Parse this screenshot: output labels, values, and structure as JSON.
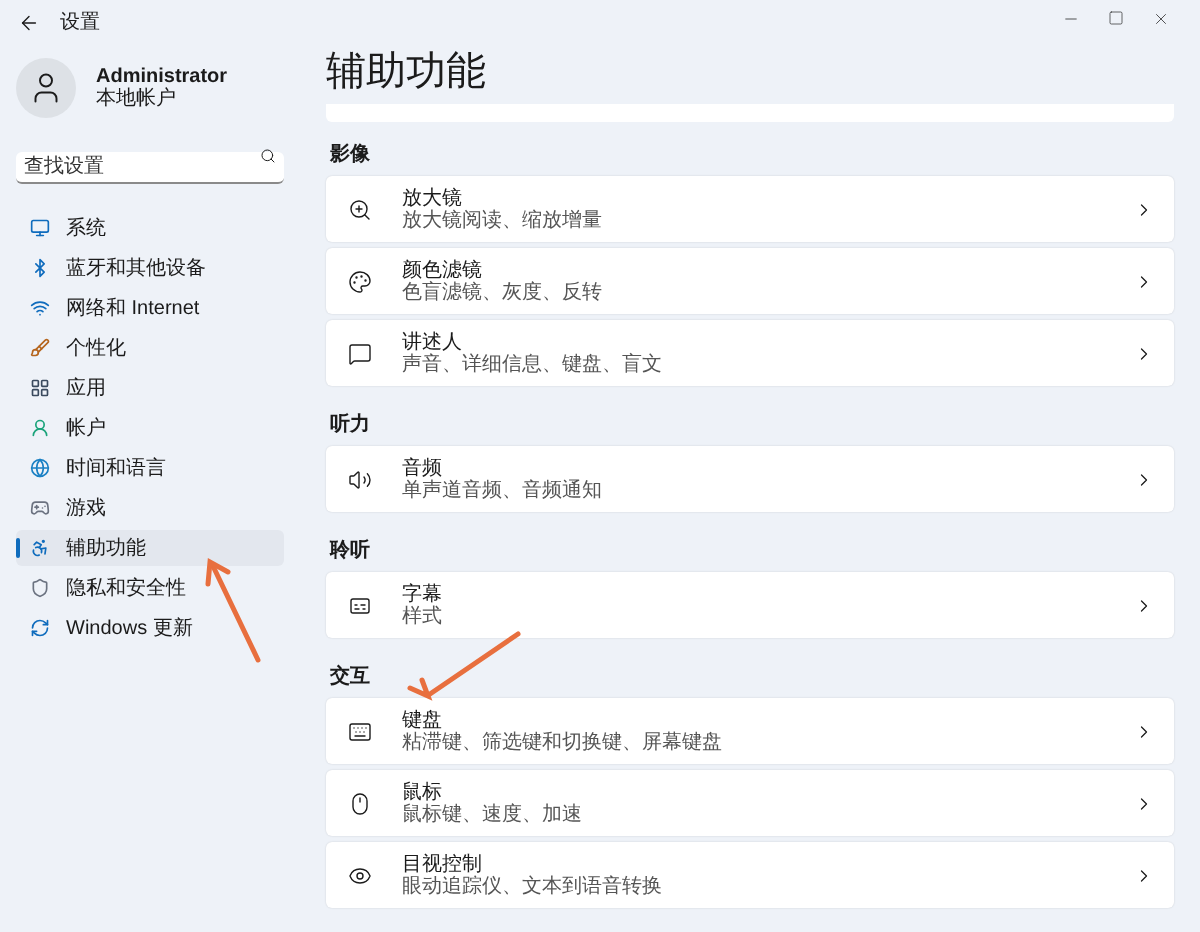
{
  "window": {
    "title": "设置"
  },
  "user": {
    "name": "Administrator",
    "account": "本地帐户"
  },
  "search": {
    "placeholder": "查找设置"
  },
  "nav": [
    {
      "kind": "system",
      "label": "系统",
      "selected": false
    },
    {
      "kind": "bluetooth",
      "label": "蓝牙和其他设备",
      "selected": false
    },
    {
      "kind": "network",
      "label": "网络和 Internet",
      "selected": false
    },
    {
      "kind": "personalize",
      "label": "个性化",
      "selected": false
    },
    {
      "kind": "apps",
      "label": "应用",
      "selected": false
    },
    {
      "kind": "accounts",
      "label": "帐户",
      "selected": false
    },
    {
      "kind": "time",
      "label": "时间和语言",
      "selected": false
    },
    {
      "kind": "gaming",
      "label": "游戏",
      "selected": false
    },
    {
      "kind": "accessibility",
      "label": "辅助功能",
      "selected": true
    },
    {
      "kind": "privacy",
      "label": "隐私和安全性",
      "selected": false
    },
    {
      "kind": "update",
      "label": "Windows 更新",
      "selected": false
    }
  ],
  "page": {
    "title": "辅助功能"
  },
  "sections": [
    {
      "heading": "影像",
      "items": [
        {
          "kind": "magnifier",
          "title": "放大镜",
          "subtitle": "放大镜阅读、缩放增量"
        },
        {
          "kind": "color",
          "title": "颜色滤镜",
          "subtitle": "色盲滤镜、灰度、反转"
        },
        {
          "kind": "narrator",
          "title": "讲述人",
          "subtitle": "声音、详细信息、键盘、盲文"
        }
      ]
    },
    {
      "heading": "听力",
      "items": [
        {
          "kind": "audio",
          "title": "音频",
          "subtitle": "单声道音频、音频通知"
        }
      ]
    },
    {
      "heading": "聆听",
      "items": [
        {
          "kind": "captions",
          "title": "字幕",
          "subtitle": "样式"
        }
      ]
    },
    {
      "heading": "交互",
      "items": [
        {
          "kind": "keyboard",
          "title": "键盘",
          "subtitle": "粘滞键、筛选键和切换键、屏幕键盘"
        },
        {
          "kind": "mouse",
          "title": "鼠标",
          "subtitle": "鼠标键、速度、加速"
        },
        {
          "kind": "eye",
          "title": "目视控制",
          "subtitle": "眼动追踪仪、文本到语音转换"
        }
      ]
    }
  ]
}
